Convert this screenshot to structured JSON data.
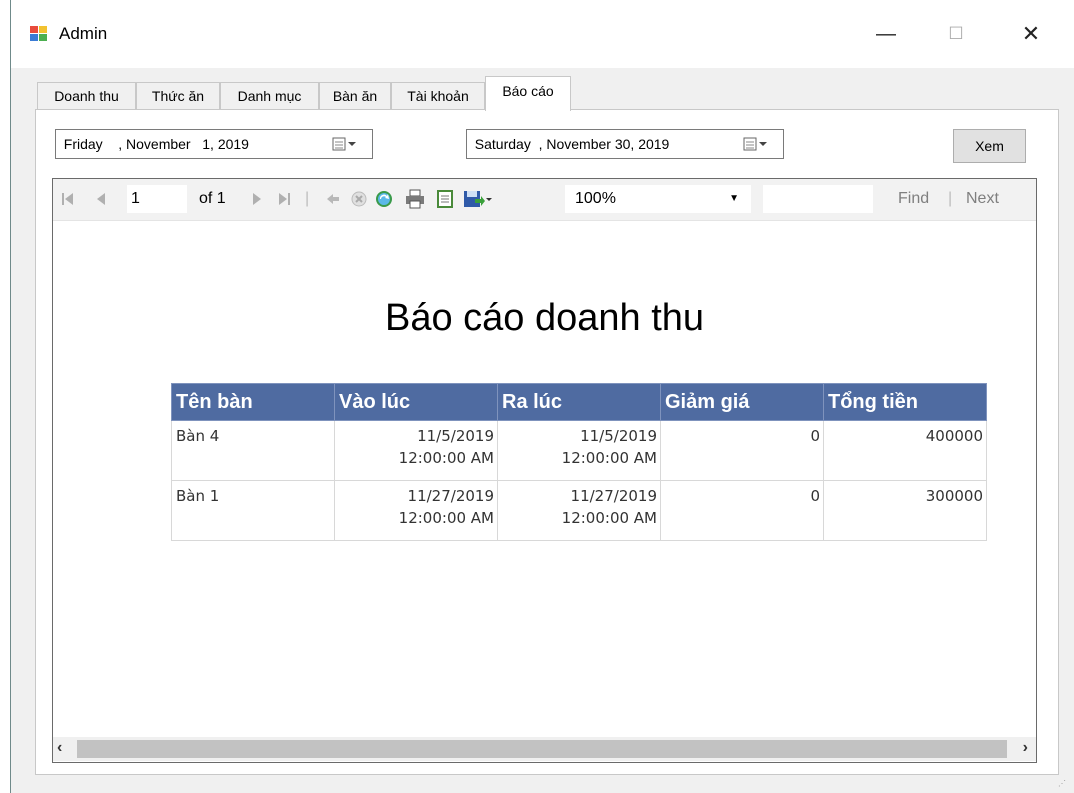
{
  "window": {
    "title": "Admin",
    "minimize": "—",
    "maximize": "☐",
    "close": "✕"
  },
  "tabs": [
    {
      "label": "Doanh thu"
    },
    {
      "label": "Thức ăn"
    },
    {
      "label": "Danh mục"
    },
    {
      "label": "Bàn ăn"
    },
    {
      "label": "Tài khoản"
    },
    {
      "label": "Báo cáo"
    }
  ],
  "active_tab": "Báo cáo",
  "filter": {
    "from_date": "  Friday    , November   1, 2019",
    "to_date": "  Saturday  , November 30, 2019",
    "view_button": "Xem"
  },
  "viewer_toolbar": {
    "page_value": "1",
    "page_of": "of 1",
    "zoom": "100%",
    "find_label": "Find",
    "next_label": "Next",
    "separator": "|",
    "icons": [
      "first-page-icon",
      "prev-page-icon",
      "next-page-icon",
      "last-page-icon",
      "back-icon",
      "stop-icon",
      "refresh-icon",
      "print-icon",
      "page-setup-icon",
      "export-icon"
    ]
  },
  "report": {
    "title": "Báo cáo doanh thu",
    "columns": [
      "Tên bàn",
      "Vào lúc",
      "Ra lúc",
      "Giảm giá",
      "Tổng tiền"
    ],
    "rows": [
      {
        "table": "Bàn 4",
        "in_date": "11/5/2019",
        "in_time": "12:00:00 AM",
        "out_date": "11/5/2019",
        "out_time": "12:00:00 AM",
        "discount": "0",
        "total": "400000"
      },
      {
        "table": "Bàn 1",
        "in_date": "11/27/2019",
        "in_time": "12:00:00 AM",
        "out_date": "11/27/2019",
        "out_time": "12:00:00 AM",
        "discount": "0",
        "total": "300000"
      }
    ]
  },
  "scrollbar": {
    "left": "‹",
    "right": "›"
  },
  "colors": {
    "header_bg": "#4f6ba1",
    "header_text": "#ffffff"
  }
}
